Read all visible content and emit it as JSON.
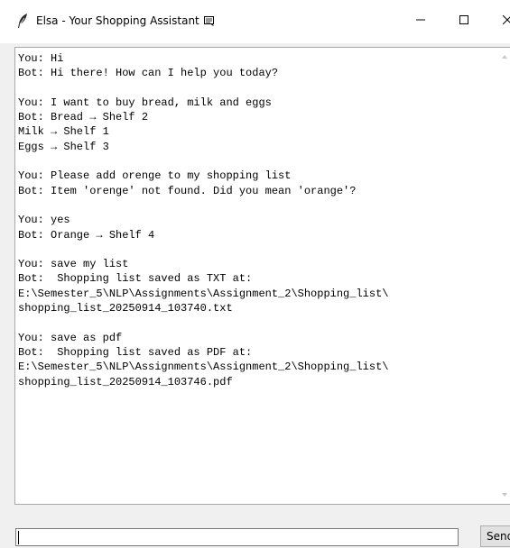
{
  "window": {
    "title": "Elsa - Your Shopping Assistant",
    "minimize_glyph": "—",
    "maximize_glyph": "☐",
    "close_glyph": "✕"
  },
  "chat": {
    "messages": [
      "You: Hi",
      "Bot: Hi there! How can I help you today?",
      "",
      "You: I want to buy bread, milk and eggs",
      "Bot: Bread → Shelf 2",
      "Milk → Shelf 1",
      "Eggs → Shelf 3",
      "",
      "You: Please add orenge to my shopping list",
      "Bot: Item 'orenge' not found. Did you mean 'orange'?",
      "",
      "You: yes",
      "Bot: Orange → Shelf 4",
      "",
      "You: save my list",
      "Bot:  Shopping list saved as TXT at:",
      "E:\\Semester_5\\NLP\\Assignments\\Assignment_2\\Shopping_list\\",
      "shopping_list_20250914_103740.txt",
      "",
      "You: save as pdf",
      "Bot:  Shopping list saved as PDF at:",
      "E:\\Semester_5\\NLP\\Assignments\\Assignment_2\\Shopping_list\\",
      "shopping_list_20250914_103746.pdf"
    ]
  },
  "input": {
    "value": "",
    "send_label": "Send"
  },
  "icons": {
    "app": "feather-icon",
    "title_decoration": "scroll-icon"
  }
}
